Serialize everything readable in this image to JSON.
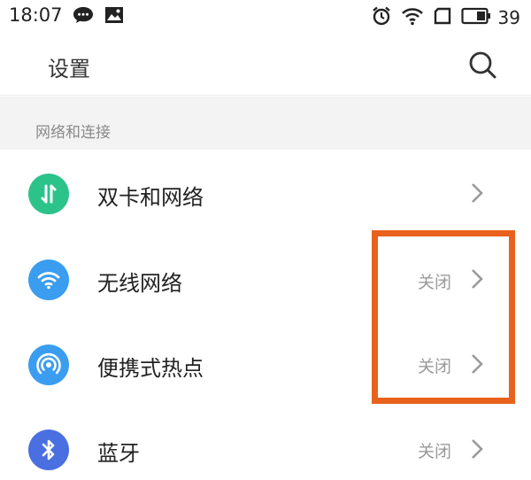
{
  "status_bar": {
    "time": "18:07",
    "battery_percent": "39"
  },
  "header": {
    "title": "设置"
  },
  "section": {
    "title": "网络和连接"
  },
  "rows": [
    {
      "label": "双卡和网络",
      "value": "",
      "icon": "dual-sim-icon",
      "icon_color": "#2cc38a"
    },
    {
      "label": "无线网络",
      "value": "关闭",
      "icon": "wifi-icon",
      "icon_color": "#3a9df0"
    },
    {
      "label": "便携式热点",
      "value": "关闭",
      "icon": "hotspot-icon",
      "icon_color": "#3a9df0"
    },
    {
      "label": "蓝牙",
      "value": "关闭",
      "icon": "bluetooth-icon",
      "icon_color": "#4a6fe0"
    }
  ],
  "annotation": {
    "color": "#e8621d"
  }
}
